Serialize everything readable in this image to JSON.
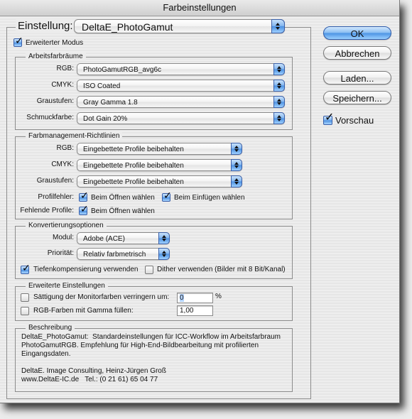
{
  "window": {
    "title": "Farbeinstellungen"
  },
  "settings": {
    "label": "Einstellung:",
    "value": "DeltaE_PhotoGamut"
  },
  "advanced_mode": {
    "label": "Erweiterter Modus",
    "checked": true
  },
  "working_spaces": {
    "title": "Arbeitsfarbräume",
    "rows": [
      {
        "label": "RGB:",
        "value": "PhotoGamutRGB_avg6c"
      },
      {
        "label": "CMYK:",
        "value": "ISO Coated"
      },
      {
        "label": "Graustufen:",
        "value": "Gray Gamma 1.8"
      },
      {
        "label": "Schmuckfarbe:",
        "value": "Dot Gain 20%"
      }
    ]
  },
  "policies": {
    "title": "Farbmanagement-Richtlinien",
    "rows": [
      {
        "label": "RGB:",
        "value": "Eingebettete Profile beibehalten"
      },
      {
        "label": "CMYK:",
        "value": "Eingebettete Profile beibehalten"
      },
      {
        "label": "Graustufen:",
        "value": "Eingebettete Profile beibehalten"
      }
    ],
    "profile_mismatch": {
      "label": "Profilfehler:",
      "ask_open": {
        "label": "Beim Öffnen wählen",
        "checked": true
      },
      "ask_paste": {
        "label": "Beim Einfügen wählen",
        "checked": true
      }
    },
    "missing_profiles": {
      "label": "Fehlende Profile:",
      "ask_open": {
        "label": "Beim Öffnen wählen",
        "checked": true
      }
    }
  },
  "conversion": {
    "title": "Konvertierungsoptionen",
    "engine": {
      "label": "Modul:",
      "value": "Adobe (ACE)"
    },
    "intent": {
      "label": "Priorität:",
      "value": "Relativ farbmetrisch"
    },
    "black_point": {
      "label": "Tiefenkompensierung verwenden",
      "checked": true
    },
    "dither": {
      "label": "Dither verwenden (Bilder mit 8 Bit/Kanal)",
      "checked": false
    }
  },
  "advanced": {
    "title": "Erweiterte Einstellungen",
    "desaturate": {
      "label": "Sättigung der Monitorfarben verringern um:",
      "checked": false,
      "value": "0",
      "unit": "%"
    },
    "blend_gamma": {
      "label": "RGB-Farben mit Gamma füllen:",
      "checked": false,
      "value": "1,00"
    }
  },
  "description": {
    "title": "Beschreibung",
    "text": "DeltaE_PhotoGamut:  Standardeinstellungen für ICC-Workflow im Arbeitsfarbraum\nPhotoGamutRGB. Empfehlung für High-End-Bildbearbeitung mit profilierten\nEingangsdaten.\n\nDeltaE. Image Consulting, Heinz-Jürgen Groß\nwww.DeltaE-IC.de   Tel.: (0 21 61) 65 04 77"
  },
  "buttons": {
    "ok": "OK",
    "cancel": "Abbrechen",
    "load": "Laden...",
    "save": "Speichern..."
  },
  "preview": {
    "label": "Vorschau",
    "checked": true
  },
  "colors": {
    "accent": "#4a92e3",
    "border": "#8c8c8c"
  }
}
